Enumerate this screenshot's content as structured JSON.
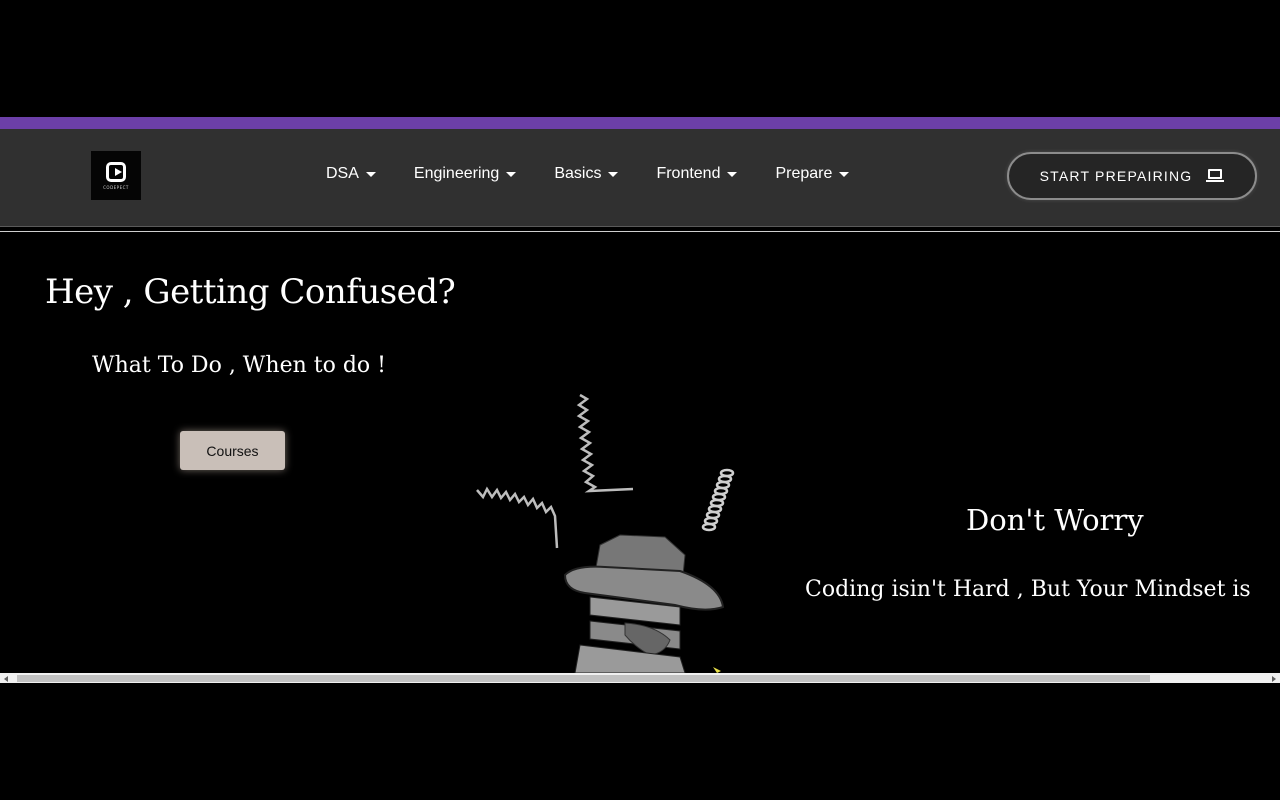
{
  "brand": {
    "logo_text": "CODEPECT",
    "logo_icon": "play-code-icon"
  },
  "nav": {
    "items": [
      {
        "label": "DSA"
      },
      {
        "label": "Engineering"
      },
      {
        "label": "Basics"
      },
      {
        "label": "Frontend"
      },
      {
        "label": "Prepare"
      }
    ],
    "cta_label": "START PREPAIRING",
    "cta_icon": "laptop-icon"
  },
  "hero": {
    "title": "Hey , Getting Confused?",
    "subtitle": "What To Do , When to do !",
    "button_label": "Courses",
    "illustration": "confused-robot-illustration"
  },
  "message": {
    "title": "Don't Worry",
    "subtitle": "Coding isin't Hard , But Your Mindset is"
  },
  "colors": {
    "accent": "#6c3fa8",
    "nav_bg": "#303030",
    "page_bg": "#000000",
    "button_bg": "#c9bfb8"
  }
}
